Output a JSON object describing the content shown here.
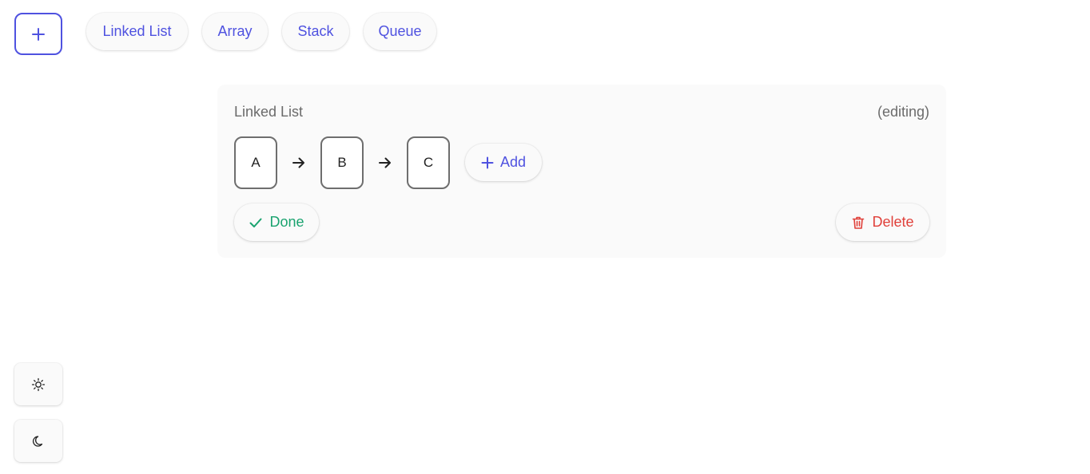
{
  "colors": {
    "accent": "#4f52e0",
    "success": "#1aa36f",
    "danger": "#e0403a",
    "muted_text": "#6b6b6b",
    "panel_bg": "#fafafa",
    "node_border": "#6e6e6e"
  },
  "toolbar": {
    "add_button_icon": "plus-icon",
    "chips": [
      {
        "label": "Linked List"
      },
      {
        "label": "Array"
      },
      {
        "label": "Stack"
      },
      {
        "label": "Queue"
      }
    ]
  },
  "panel": {
    "title": "Linked List",
    "status": "(editing)",
    "nodes": [
      {
        "label": "A"
      },
      {
        "label": "B"
      },
      {
        "label": "C"
      }
    ],
    "arrow_icon": "arrow-right-icon",
    "add_button": {
      "label": "Add",
      "icon": "plus-icon"
    },
    "done_button": {
      "label": "Done",
      "icon": "check-icon"
    },
    "delete_button": {
      "label": "Delete",
      "icon": "trash-icon"
    }
  },
  "theme": {
    "light_icon": "sun-icon",
    "dark_icon": "moon-icon"
  }
}
